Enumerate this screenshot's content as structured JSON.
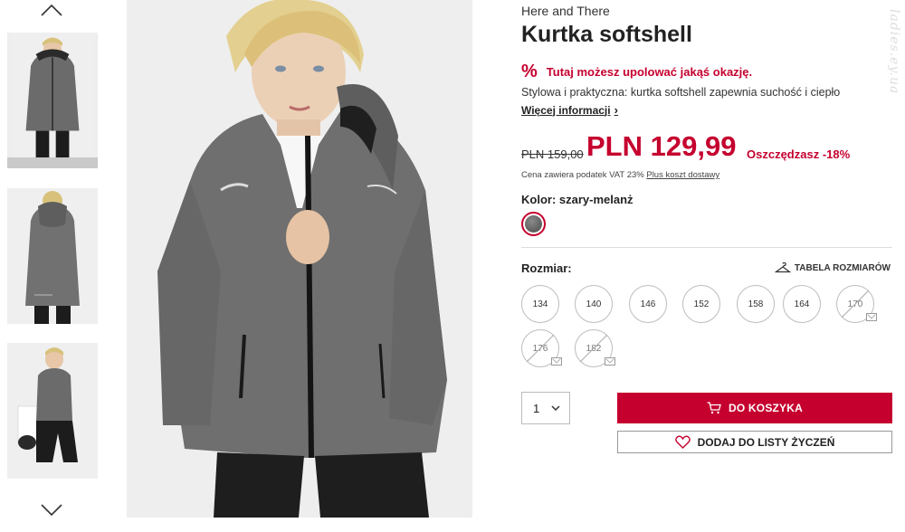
{
  "watermark": "ladies.ey.ua",
  "gallery": {
    "up_icon": "chevron-up-icon",
    "down_icon": "chevron-down-icon",
    "thumbnails": [
      "front view",
      "back view",
      "seated view"
    ]
  },
  "product": {
    "brand": "Here and There",
    "title": "Kurtka softshell",
    "deal_icon": "%",
    "deal_text": "Tutaj możesz upolować jakąś okazję.",
    "description": "Stylowa i praktyczna: kurtka softshell zapewnia suchość i ciepło",
    "more_info": "Więcej informacji",
    "old_price": "PLN 159,00",
    "new_price": "PLN 129,99",
    "savings": "Oszczędzasz -18%",
    "vat_text": "Cena zawiera podatek VAT 23%",
    "shipping_link": "Plus koszt dostawy",
    "color_label": "Kolor: szary-melanż",
    "size_label": "Rozmiar:",
    "size_table": "TABELA ROZMIARÓW",
    "sizes": [
      {
        "label": "134",
        "available": true
      },
      {
        "label": "140",
        "available": true
      },
      {
        "label": "146",
        "available": true
      },
      {
        "label": "152",
        "available": true
      },
      {
        "label": "158",
        "available": true
      },
      {
        "label": "164",
        "available": true
      },
      {
        "label": "170",
        "available": false
      },
      {
        "label": "176",
        "available": false
      },
      {
        "label": "182",
        "available": false
      }
    ],
    "quantity": "1",
    "add_to_cart": "DO KOSZYKA",
    "add_to_wishlist": "DODAJ DO LISTY ŻYCZEŃ"
  },
  "colors": {
    "accent": "#c5002e",
    "swatch": "#5c5c5c"
  }
}
